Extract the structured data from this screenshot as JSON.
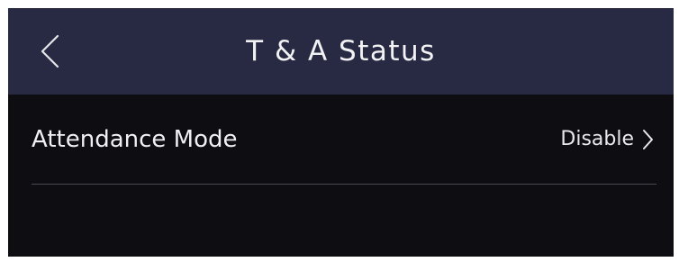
{
  "header": {
    "title": "T & A Status",
    "back_icon": "chevron-left-icon"
  },
  "settings": {
    "rows": [
      {
        "label": "Attendance Mode",
        "value": "Disable",
        "icon": "chevron-right-icon"
      }
    ]
  },
  "colors": {
    "header_bg": "#272a42",
    "body_bg": "#0d0d12",
    "text": "#f0f0f3",
    "divider": "#4a4a52"
  }
}
